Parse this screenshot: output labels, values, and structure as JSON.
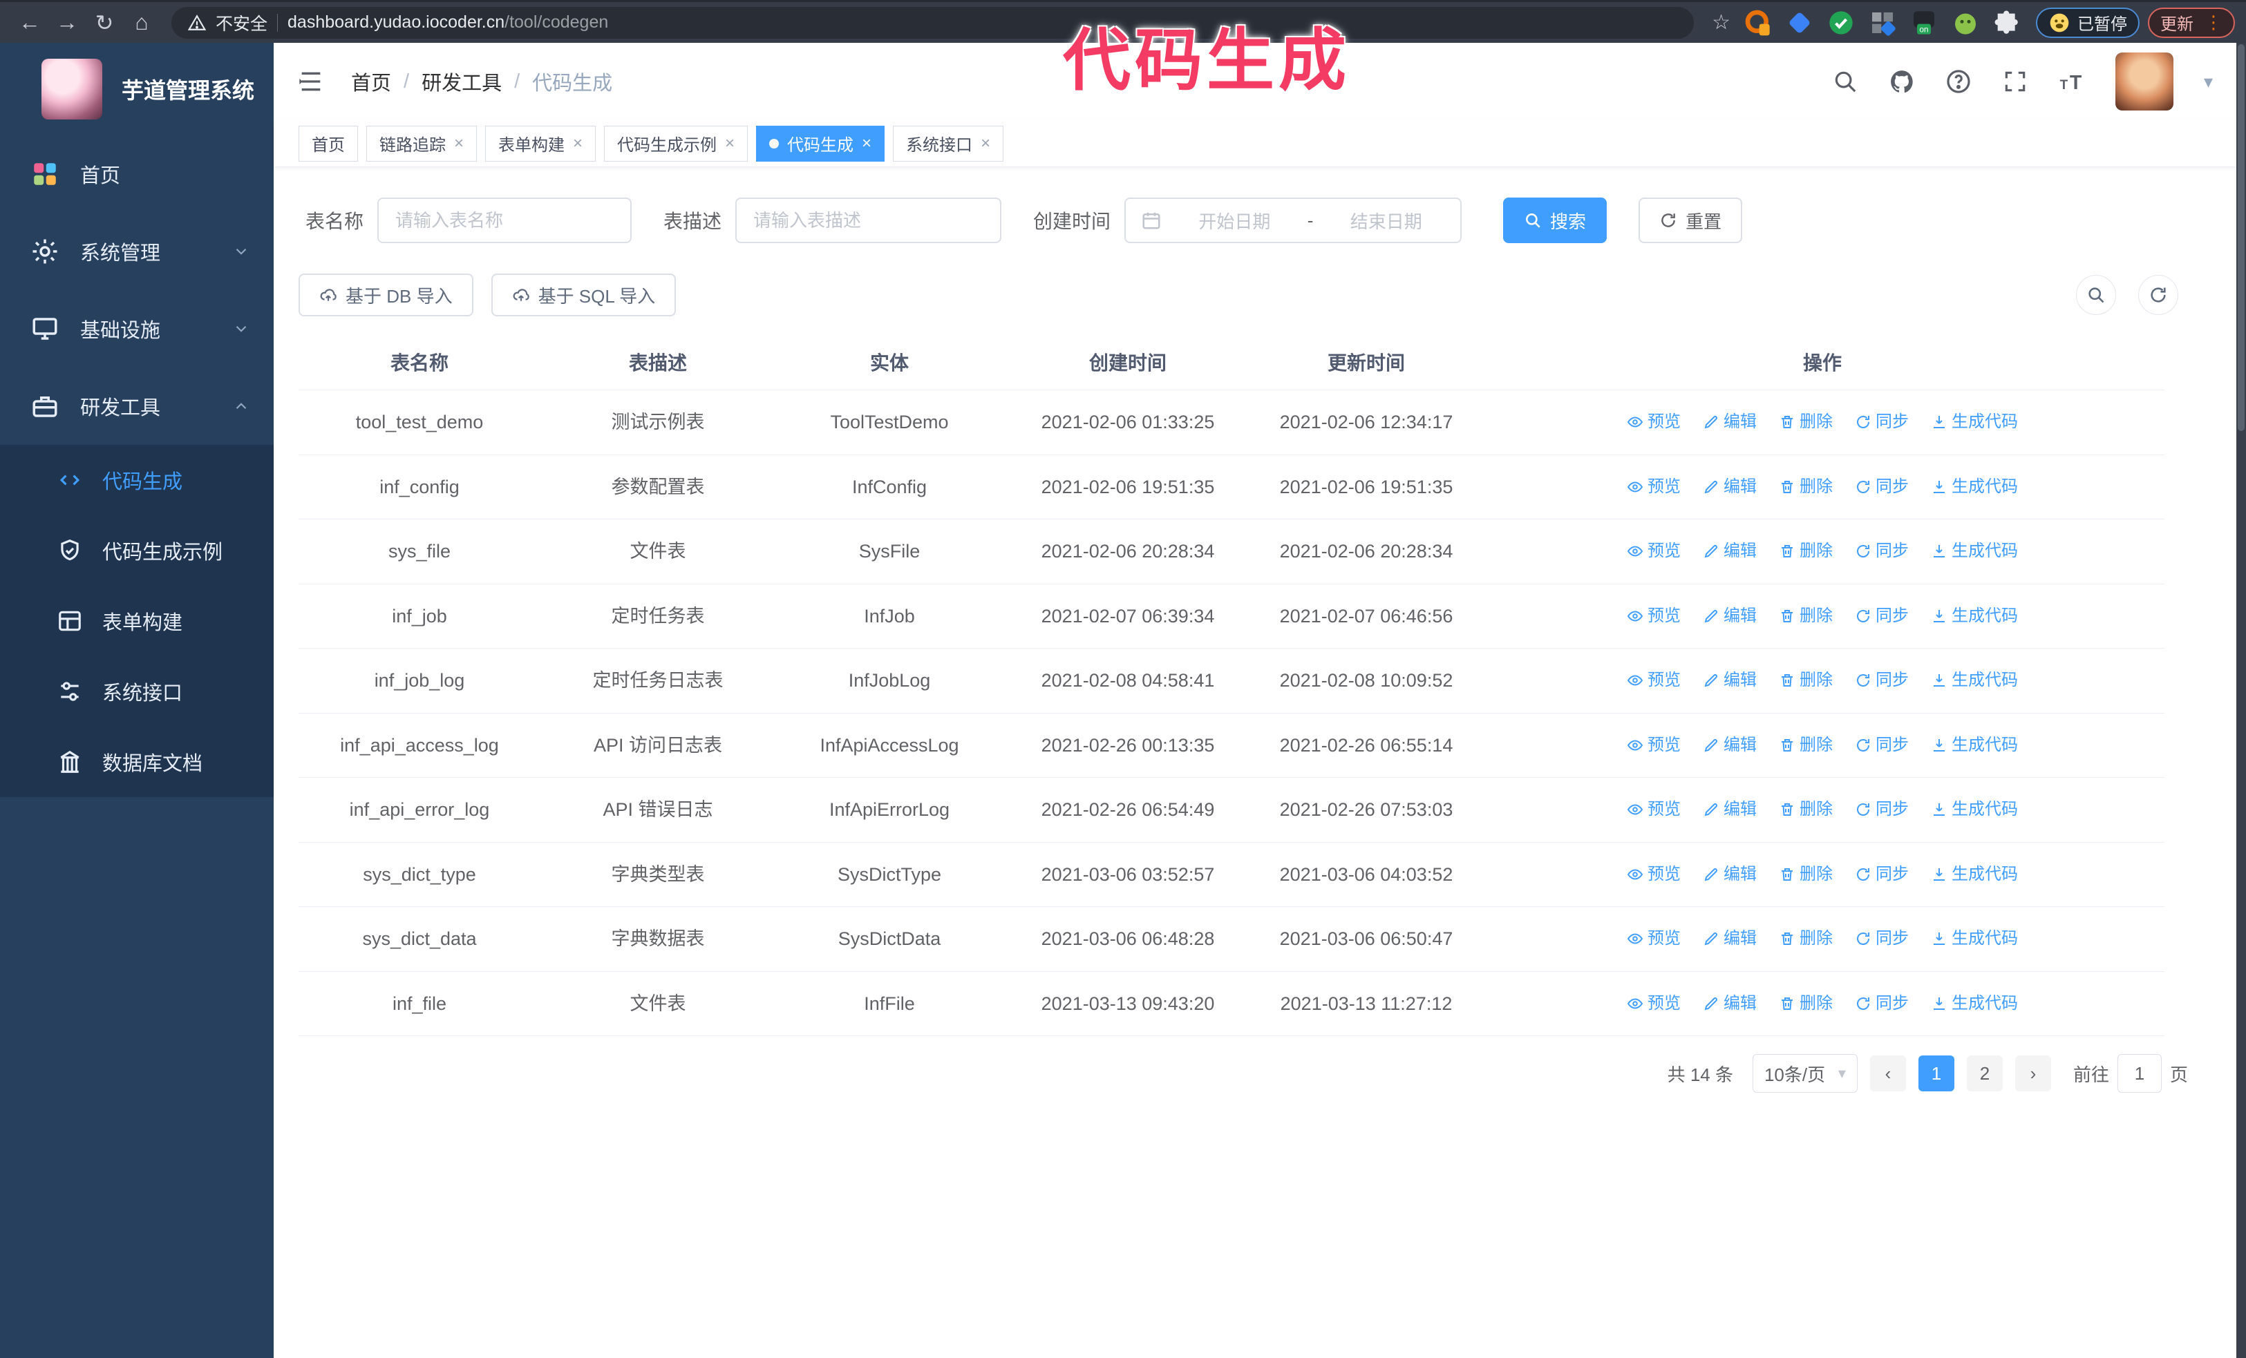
{
  "browser": {
    "nav_icons": [
      "back-icon",
      "forward-icon",
      "reload-icon",
      "home-icon"
    ],
    "security_label": "不安全",
    "url_domain": "dashboard.yudao.iocoder.cn",
    "url_path": "/tool/codegen",
    "bookmark_icon": "bookmark-star-icon",
    "extensions": [
      "adblock-orange-icon",
      "gem-blue-icon",
      "check-green-icon",
      "grid-gray-icon",
      "dark-on-icon",
      "green-bot-icon",
      "puzzle-icon"
    ],
    "paused_badge": "已暂停",
    "update_button": "更新"
  },
  "annotation": {
    "title": "代码生成"
  },
  "sidebar": {
    "app_title": "芋道管理系统",
    "items": [
      {
        "label": "首页",
        "icon": "dashboard-icon",
        "expandable": false,
        "expanded": false
      },
      {
        "label": "系统管理",
        "icon": "gear-icon",
        "expandable": true,
        "expanded": false
      },
      {
        "label": "基础设施",
        "icon": "monitor-icon",
        "expandable": true,
        "expanded": false
      },
      {
        "label": "研发工具",
        "icon": "toolbox-icon",
        "expandable": true,
        "expanded": true
      }
    ],
    "sub_items": [
      {
        "label": "代码生成",
        "icon": "code-icon",
        "active": true
      },
      {
        "label": "代码生成示例",
        "icon": "shield-check-icon",
        "active": false
      },
      {
        "label": "表单构建",
        "icon": "form-icon",
        "active": false
      },
      {
        "label": "系统接口",
        "icon": "sliders-icon",
        "active": false
      },
      {
        "label": "数据库文档",
        "icon": "columns-icon",
        "active": false
      }
    ]
  },
  "header": {
    "breadcrumb": [
      "首页",
      "研发工具",
      "代码生成"
    ],
    "icons": [
      "search-icon",
      "github-icon",
      "help-icon",
      "fullscreen-icon",
      "font-size-icon"
    ]
  },
  "tabs": [
    {
      "label": "首页",
      "closable": false,
      "active": false
    },
    {
      "label": "链路追踪",
      "closable": true,
      "active": false
    },
    {
      "label": "表单构建",
      "closable": true,
      "active": false
    },
    {
      "label": "代码生成示例",
      "closable": true,
      "active": false
    },
    {
      "label": "代码生成",
      "closable": true,
      "active": true
    },
    {
      "label": "系统接口",
      "closable": true,
      "active": false
    }
  ],
  "filters": {
    "table_name_label": "表名称",
    "table_name_placeholder": "请输入表名称",
    "table_desc_label": "表描述",
    "table_desc_placeholder": "请输入表描述",
    "create_time_label": "创建时间",
    "date_start_placeholder": "开始日期",
    "date_separator": "-",
    "date_end_placeholder": "结束日期",
    "search_label": "搜索",
    "reset_label": "重置"
  },
  "toolbar": {
    "import_db_label": "基于 DB 导入",
    "import_sql_label": "基于 SQL 导入"
  },
  "table": {
    "columns": [
      "表名称",
      "表描述",
      "实体",
      "创建时间",
      "更新时间",
      "操作"
    ],
    "actions": [
      {
        "label": "预览",
        "icon": "eye-icon"
      },
      {
        "label": "编辑",
        "icon": "pencil-icon"
      },
      {
        "label": "删除",
        "icon": "trash-icon"
      },
      {
        "label": "同步",
        "icon": "sync-icon"
      },
      {
        "label": "生成代码",
        "icon": "download-icon"
      }
    ],
    "rows": [
      {
        "name": "tool_test_demo",
        "description": "测试示例表",
        "entity": "ToolTestDemo",
        "created": "2021-02-06 01:33:25",
        "updated": "2021-02-06 12:34:17"
      },
      {
        "name": "inf_config",
        "description": "参数配置表",
        "entity": "InfConfig",
        "created": "2021-02-06 19:51:35",
        "updated": "2021-02-06 19:51:35"
      },
      {
        "name": "sys_file",
        "description": "文件表",
        "entity": "SysFile",
        "created": "2021-02-06 20:28:34",
        "updated": "2021-02-06 20:28:34"
      },
      {
        "name": "inf_job",
        "description": "定时任务表",
        "entity": "InfJob",
        "created": "2021-02-07 06:39:34",
        "updated": "2021-02-07 06:46:56"
      },
      {
        "name": "inf_job_log",
        "description": "定时任务日志表",
        "entity": "InfJobLog",
        "created": "2021-02-08 04:58:41",
        "updated": "2021-02-08 10:09:52"
      },
      {
        "name": "inf_api_access_log",
        "description": "API 访问日志表",
        "entity": "InfApiAccessLog",
        "created": "2021-02-26 00:13:35",
        "updated": "2021-02-26 06:55:14"
      },
      {
        "name": "inf_api_error_log",
        "description": "API 错误日志",
        "entity": "InfApiErrorLog",
        "created": "2021-02-26 06:54:49",
        "updated": "2021-02-26 07:53:03"
      },
      {
        "name": "sys_dict_type",
        "description": "字典类型表",
        "entity": "SysDictType",
        "created": "2021-03-06 03:52:57",
        "updated": "2021-03-06 04:03:52"
      },
      {
        "name": "sys_dict_data",
        "description": "字典数据表",
        "entity": "SysDictData",
        "created": "2021-03-06 06:48:28",
        "updated": "2021-03-06 06:50:47"
      },
      {
        "name": "inf_file",
        "description": "文件表",
        "entity": "InfFile",
        "created": "2021-03-13 09:43:20",
        "updated": "2021-03-13 11:27:12"
      }
    ]
  },
  "pagination": {
    "total_label": "共 14 条",
    "page_size": "10条/页",
    "prev_icon": "chevron-left-icon",
    "next_icon": "chevron-right-icon",
    "pages": [
      {
        "label": "1",
        "active": true
      },
      {
        "label": "2",
        "active": false
      }
    ],
    "goto_label": "前往",
    "goto_value": "1",
    "goto_suffix": "页"
  },
  "colors": {
    "accent": "#409eff",
    "annotation_pink": "#f43b63",
    "sidebar_bg": "#27405e",
    "submenu_bg": "#1f344e",
    "chrome_bg": "#353b47"
  }
}
